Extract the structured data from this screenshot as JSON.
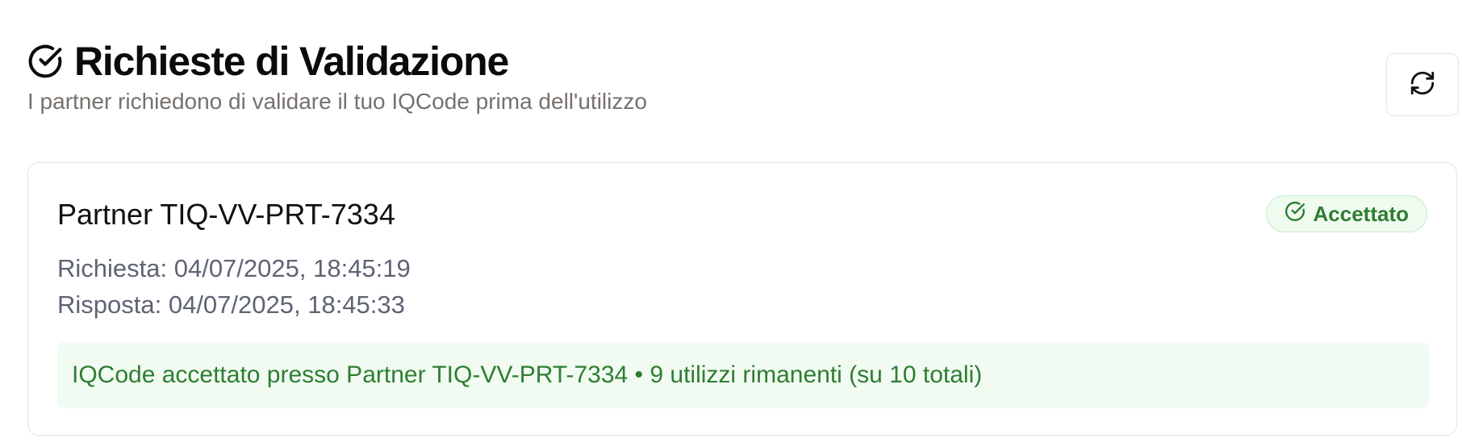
{
  "header": {
    "icon": "check-circle-icon",
    "title": "Richieste di Validazione",
    "subtitle": "I partner richiedono di validare il tuo IQCode prima dell'utilizzo"
  },
  "toolbar": {
    "refresh_icon": "refresh-icon"
  },
  "requests": [
    {
      "partner": "Partner TIQ-VV-PRT-7334",
      "status": {
        "label": "Accettato",
        "icon": "check-circle-icon",
        "color": "#2e7d32"
      },
      "requested": "Richiesta: 04/07/2025, 18:45:19",
      "responded": "Risposta: 04/07/2025, 18:45:33",
      "result_message": "IQCode accettato presso Partner TIQ-VV-PRT-7334 • 9 utilizzi rimanenti (su 10 totali)"
    }
  ],
  "colors": {
    "accent_green": "#2e7d32",
    "badge_bg": "#f0fbf0",
    "result_bg": "#f1fbf1",
    "muted_text": "#77716d"
  }
}
